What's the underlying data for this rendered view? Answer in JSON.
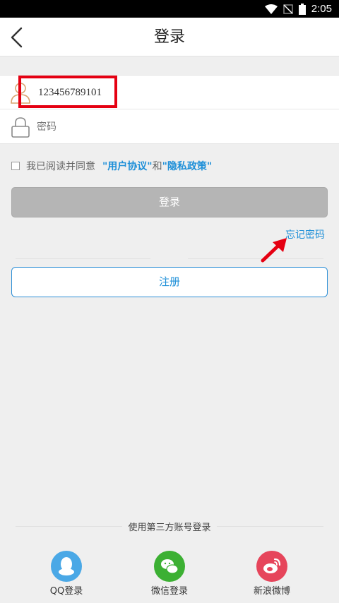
{
  "status_bar": {
    "time": "2:05"
  },
  "header": {
    "title": "登录"
  },
  "form": {
    "username_value": "123456789101",
    "password_placeholder": "密码"
  },
  "agreement": {
    "prefix": "我已阅读并同意",
    "user_agreement": "\"用户协议\"",
    "and": "和",
    "privacy_policy": "\"隐私政策\""
  },
  "buttons": {
    "login": "登录",
    "forgot_password": "忘记密码",
    "register": "注册"
  },
  "third_party": {
    "title": "使用第三方账号登录",
    "items": [
      {
        "label": "QQ登录",
        "icon": "qq-icon",
        "color": "#4aa8e6"
      },
      {
        "label": "微信登录",
        "icon": "wechat-icon",
        "color": "#3cb033"
      },
      {
        "label": "新浪微博",
        "icon": "weibo-icon",
        "color": "#e6455b"
      }
    ]
  },
  "colors": {
    "accent": "#1d8fd8",
    "highlight": "#e50012"
  }
}
